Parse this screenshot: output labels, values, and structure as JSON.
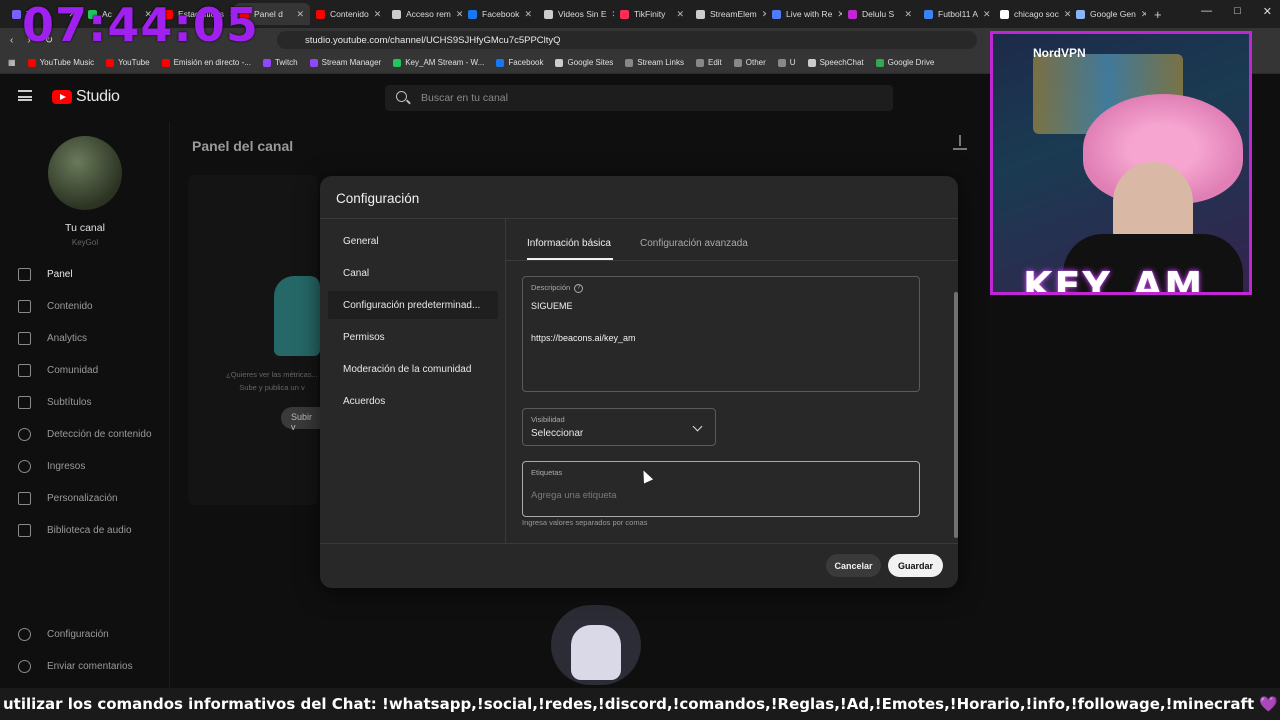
{
  "overlay": {
    "clock": "07:44:05",
    "ticker": "utilizar los comandos informativos del Chat: !whatsapp,!social,!redes,!discord,!comandos,!Reglas,!Ad,!Emotes,!Horario,!info,!followage,!minecraft 💜 💜 💜",
    "webcam_vpn": "NordVPN",
    "webcam_name": "KEY_AM"
  },
  "browser": {
    "tabs": [
      {
        "label": "T",
        "color": "#7b61ff"
      },
      {
        "label": "Ac",
        "color": "#22c55e"
      },
      {
        "label": "Estadísticas",
        "color": "#ff0000"
      },
      {
        "label": "Panel d",
        "color": "#ff0000",
        "active": true
      },
      {
        "label": "Contenido",
        "color": "#ff0000"
      },
      {
        "label": "Acceso rem",
        "color": "#cccccc"
      },
      {
        "label": "Facebook",
        "color": "#1877f2"
      },
      {
        "label": "Videos Sin E",
        "color": "#cccccc"
      },
      {
        "label": "TikFinity",
        "color": "#ff2d55"
      },
      {
        "label": "StreamElem",
        "color": "#cccccc"
      },
      {
        "label": "Live with Re",
        "color": "#4f7cff"
      },
      {
        "label": "Delulu S",
        "color": "#c026d3"
      },
      {
        "label": "Futbol11 A",
        "color": "#3b82f6"
      },
      {
        "label": "chicago soc",
        "color": "#ffffff"
      },
      {
        "label": "Google Gen",
        "color": "#8ab4f8"
      }
    ],
    "url": "studio.youtube.com/channel/UCHS9SJHfyGMcu7c5PPCltyQ",
    "bookmarks": [
      {
        "label": "YouTube Music",
        "color": "#ff0000"
      },
      {
        "label": "YouTube",
        "color": "#ff0000"
      },
      {
        "label": "Emisión en directo -...",
        "color": "#ff0000"
      },
      {
        "label": "Twitch",
        "color": "#9146ff"
      },
      {
        "label": "Stream Manager",
        "color": "#9146ff"
      },
      {
        "label": "Key_AM Stream - W...",
        "color": "#22c55e"
      },
      {
        "label": "Facebook",
        "color": "#1877f2"
      },
      {
        "label": "Google Sites",
        "color": "#cccccc"
      },
      {
        "label": "Stream Links",
        "color": "#888888"
      },
      {
        "label": "Edit",
        "color": "#888888"
      },
      {
        "label": "Other",
        "color": "#888888"
      },
      {
        "label": "U",
        "color": "#888888"
      },
      {
        "label": "SpeechChat",
        "color": "#cccccc"
      },
      {
        "label": "Google Drive",
        "color": "#34a853"
      }
    ]
  },
  "studio": {
    "logo_text": "Studio",
    "search_placeholder": "Buscar en tu canal",
    "channel_label": "Tu canal",
    "channel_handle": "KeyGol",
    "page_title": "Panel del canal",
    "card_hint": "¿Quieres ver las métricas... Sube y publica un v",
    "card_button": "Subir v",
    "nav": [
      {
        "label": "Panel",
        "active": true
      },
      {
        "label": "Contenido"
      },
      {
        "label": "Analytics"
      },
      {
        "label": "Comunidad"
      },
      {
        "label": "Subtítulos"
      },
      {
        "label": "Detección de contenido"
      },
      {
        "label": "Ingresos"
      },
      {
        "label": "Personalización"
      },
      {
        "label": "Biblioteca de audio"
      }
    ],
    "nav_bottom": [
      {
        "label": "Configuración"
      },
      {
        "label": "Enviar comentarios"
      }
    ]
  },
  "modal": {
    "title": "Configuración",
    "nav": [
      {
        "label": "General"
      },
      {
        "label": "Canal"
      },
      {
        "label": "Configuración predeterminad...",
        "active": true
      },
      {
        "label": "Permisos"
      },
      {
        "label": "Moderación de la comunidad"
      },
      {
        "label": "Acuerdos"
      }
    ],
    "tabs": [
      {
        "label": "Información básica",
        "active": true
      },
      {
        "label": "Configuración avanzada"
      }
    ],
    "description": {
      "label": "Descripción",
      "line1": "SIGUEME",
      "line2": "https://beacons.ai/key_am"
    },
    "visibility": {
      "label": "Visibilidad",
      "value": "Seleccionar"
    },
    "tags": {
      "label": "Etiquetas",
      "placeholder": "Agrega una etiqueta",
      "helper": "Ingresa valores separados por comas"
    },
    "cancel": "Cancelar",
    "save": "Guardar"
  }
}
